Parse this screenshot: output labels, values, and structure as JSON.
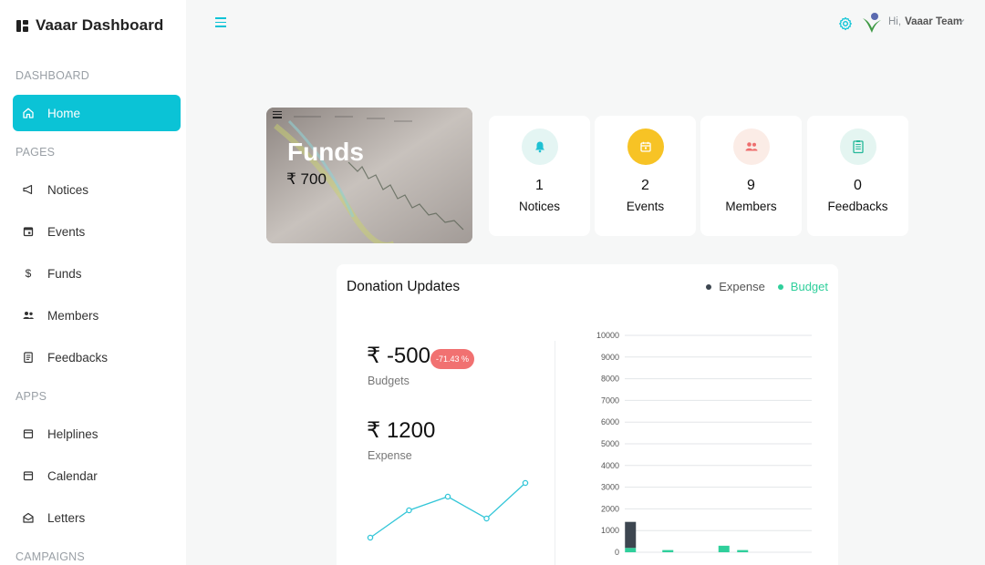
{
  "brand": {
    "name": "Vaaar Dashboard"
  },
  "sidebar": {
    "sections": {
      "dashboard": "DASHBOARD",
      "pages": "PAGES",
      "apps": "APPS",
      "campaigns": "CAMPAIGNS"
    },
    "items": [
      {
        "label": "Home",
        "icon": "home-icon",
        "active": true
      },
      {
        "label": "Notices",
        "icon": "megaphone-icon"
      },
      {
        "label": "Events",
        "icon": "calendar-event-icon"
      },
      {
        "label": "Funds",
        "icon": "dollar-icon"
      },
      {
        "label": "Members",
        "icon": "people-icon"
      },
      {
        "label": "Feedbacks",
        "icon": "clipboard-icon"
      },
      {
        "label": "Helplines",
        "icon": "calendar-icon"
      },
      {
        "label": "Calendar",
        "icon": "calendar-icon"
      },
      {
        "label": "Letters",
        "icon": "envelope-open-icon"
      }
    ]
  },
  "header": {
    "greeting": "Hi,",
    "user": "Vaaar Team"
  },
  "funds": {
    "title": "Funds",
    "value": "₹ 700"
  },
  "stats": [
    {
      "count": "1",
      "label": "Notices",
      "icon": "bell-icon",
      "bg": "#e4f5f3",
      "fg": "#1fc1d3"
    },
    {
      "count": "2",
      "label": "Events",
      "icon": "calendar-icon",
      "bg": "#f7c325",
      "fg": "#ffffff"
    },
    {
      "count": "9",
      "label": "Members",
      "icon": "people-icon",
      "bg": "#fbece6",
      "fg": "#ee6e6e"
    },
    {
      "count": "0",
      "label": "Feedbacks",
      "icon": "clipboard-icon",
      "bg": "#e4f5f1",
      "fg": "#26b89a"
    }
  ],
  "donation": {
    "title": "Donation Updates",
    "legend": [
      {
        "label": "Expense",
        "color": "#3d4650"
      },
      {
        "label": "Budget",
        "color": "#2fcf9b"
      }
    ],
    "budget_value": "₹ -500",
    "budget_label": "Budgets",
    "budget_change": "-71.43 %",
    "expense_value": "₹ 1200",
    "expense_label": "Expense"
  },
  "colors": {
    "accent": "#0bc3d6",
    "badge": "#f17171"
  },
  "chart_data": {
    "type": "bar",
    "stacked": true,
    "ylim": [
      0,
      10000
    ],
    "y_ticks": [
      "0",
      "1000",
      "2000",
      "3000",
      "4000",
      "5000",
      "6000",
      "7000",
      "8000",
      "9000",
      "10000"
    ],
    "series": [
      {
        "name": "Expense",
        "values": [
          1200,
          0,
          0,
          0,
          0,
          0,
          0,
          0,
          0,
          0
        ]
      },
      {
        "name": "Budget",
        "values": [
          200,
          0,
          100,
          0,
          0,
          300,
          100,
          0,
          0,
          0
        ]
      }
    ],
    "grid": true,
    "legend_position": "top-right"
  },
  "sparkline": {
    "values": [
      1,
      3,
      4,
      2.4,
      5
    ]
  }
}
